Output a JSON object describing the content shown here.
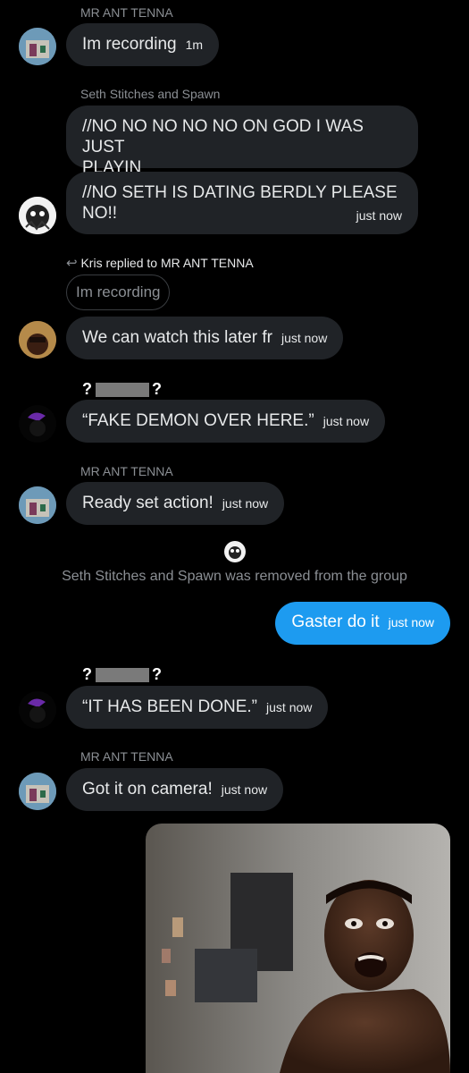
{
  "messages": {
    "m1": {
      "sender": "MR ANT TENNA",
      "text": "Im recording",
      "time": "1m"
    },
    "m2": {
      "sender": "Seth Stitches and Spawn",
      "line1": "//NO NO NO NO NO ON GOD I WAS JUST",
      "line2": "PLAYIN"
    },
    "m3": {
      "line1": "//NO SETH IS DATING BERDLY PLEASE",
      "line2": "NO!!",
      "time": "just now"
    },
    "reply": {
      "label": "Kris replied to MR ANT TENNA",
      "quoted": "Im recording"
    },
    "m4": {
      "text": "We can watch this later fr",
      "time": "just now"
    },
    "m5": {
      "sender_left": "?",
      "sender_right": "?",
      "text": "“FAKE DEMON OVER HERE.”",
      "time": "just now"
    },
    "m6": {
      "sender": "MR ANT TENNA",
      "text": "Ready set action!",
      "time": "just now"
    },
    "system": "Seth Stitches and Spawn was removed from the group",
    "m7": {
      "text": "Gaster do it",
      "time": "just now"
    },
    "m8": {
      "sender_left": "?",
      "sender_right": "?",
      "text": "“IT HAS BEEN DONE.”",
      "time": "just now"
    },
    "m9": {
      "sender": "MR ANT TENNA",
      "text": "Got it on camera!",
      "time": "just now"
    }
  },
  "colors": {
    "bubble": "#202327",
    "mine": "#1d9bf0",
    "muted": "#8b8f94"
  }
}
